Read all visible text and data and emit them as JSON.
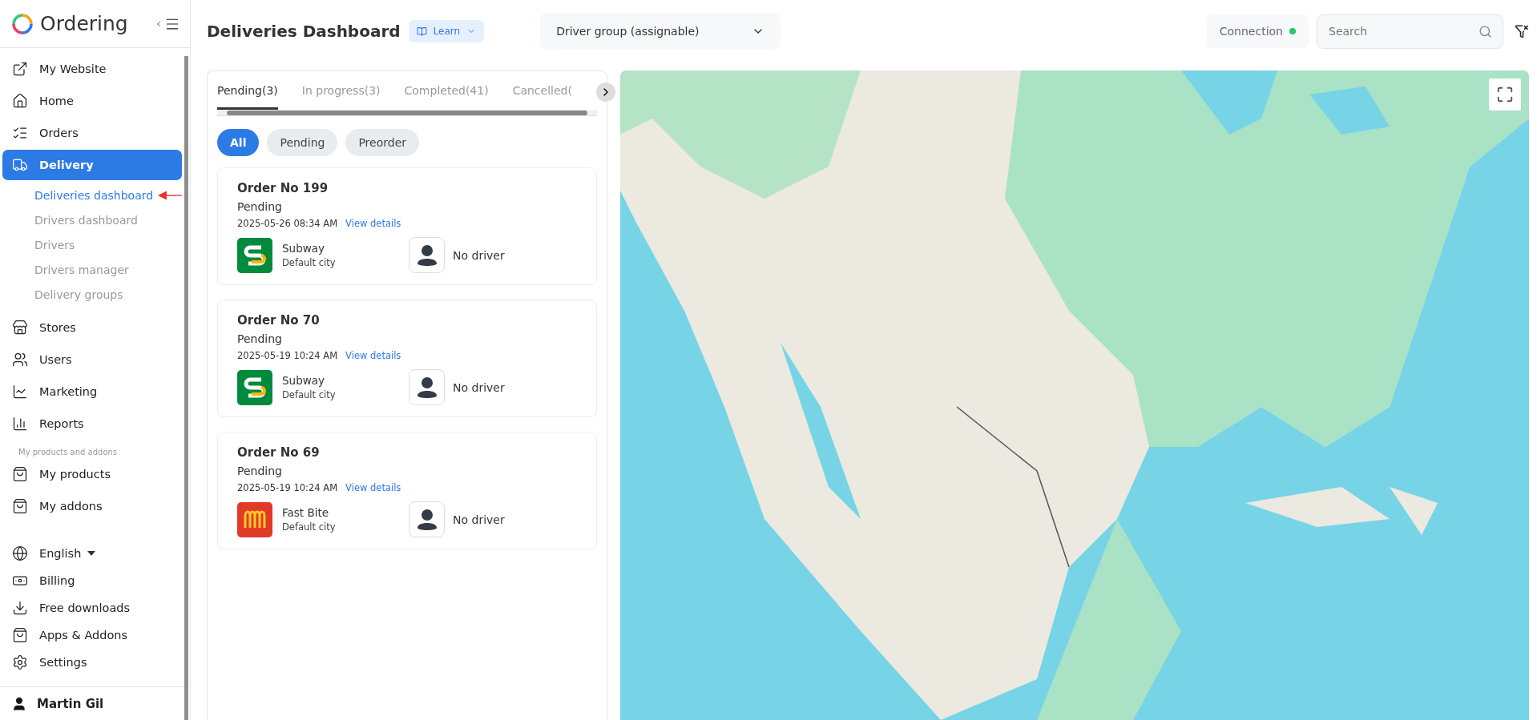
{
  "brand": {
    "name": "Ordering"
  },
  "sidebar": {
    "items": [
      {
        "label": "My Website",
        "selected": false
      },
      {
        "label": "Home",
        "selected": false
      },
      {
        "label": "Orders",
        "selected": false
      },
      {
        "label": "Delivery",
        "selected": true,
        "children": [
          {
            "label": "Deliveries dashboard",
            "selected": true
          },
          {
            "label": "Drivers dashboard",
            "selected": false
          },
          {
            "label": "Drivers",
            "selected": false
          },
          {
            "label": "Drivers manager",
            "selected": false
          },
          {
            "label": "Delivery groups",
            "selected": false
          }
        ]
      },
      {
        "label": "Stores",
        "selected": false
      },
      {
        "label": "Users",
        "selected": false
      },
      {
        "label": "Marketing",
        "selected": false
      },
      {
        "label": "Reports",
        "selected": false
      }
    ],
    "section_label": "My products and addons",
    "product_items": [
      {
        "label": "My products",
        "selected": false
      },
      {
        "label": "My addons",
        "selected": false
      }
    ],
    "bottom_items": [
      {
        "label": "English",
        "kind": "dropdown"
      },
      {
        "label": "Billing",
        "kind": "link"
      },
      {
        "label": "Free downloads",
        "kind": "link"
      },
      {
        "label": "Apps & Addons",
        "kind": "link"
      },
      {
        "label": "Settings",
        "kind": "link"
      }
    ],
    "user": {
      "name": "Martin Gil"
    }
  },
  "header": {
    "title": "Deliveries Dashboard",
    "learn_button": "Learn",
    "driver_group": "Driver group (assignable)",
    "connection": {
      "label": "Connection",
      "online": true
    },
    "search": {
      "placeholder": "Search"
    }
  },
  "tabs": [
    {
      "label": "Pending(3)",
      "selected": true
    },
    {
      "label": "In progress(3)",
      "selected": false
    },
    {
      "label": "Completed(41)",
      "selected": false
    },
    {
      "label": "Cancelled(",
      "selected": false
    }
  ],
  "filters": [
    {
      "label": "All",
      "selected": true
    },
    {
      "label": "Pending",
      "selected": false
    },
    {
      "label": "Preorder",
      "selected": false
    }
  ],
  "orders": [
    {
      "title": "Order No 199",
      "status": "Pending",
      "date": "2025-05-26 08:34 AM",
      "link": "View details",
      "store": "Subway",
      "city": "Default city",
      "driver": "No driver"
    },
    {
      "title": "Order No 70",
      "status": "Pending",
      "date": "2025-05-19 10:24 AM",
      "link": "View details",
      "store": "Subway",
      "city": "Default city",
      "driver": "No driver"
    },
    {
      "title": "Order No 69",
      "status": "Pending",
      "date": "2025-05-19 10:24 AM",
      "link": "View details",
      "store": "Fast Bite",
      "city": "Default city",
      "driver": "No driver"
    }
  ]
}
